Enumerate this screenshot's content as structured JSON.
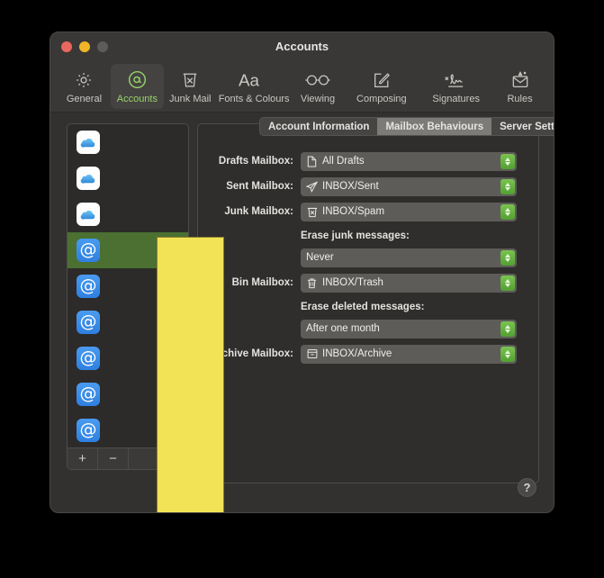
{
  "window": {
    "title": "Accounts",
    "traffic_lights": [
      "close-button",
      "minimise-button",
      "zoom-button"
    ]
  },
  "toolbar": {
    "items": [
      {
        "label": "General",
        "icon": "gear-icon",
        "selected": false
      },
      {
        "label": "Accounts",
        "icon": "at-circle-icon",
        "selected": true
      },
      {
        "label": "Junk Mail",
        "icon": "junk-bin-icon",
        "selected": false
      },
      {
        "label": "Fonts & Colours",
        "icon": "font-aa-icon",
        "selected": false
      },
      {
        "label": "Viewing",
        "icon": "glasses-icon",
        "selected": false
      },
      {
        "label": "Composing",
        "icon": "compose-pencil-icon",
        "selected": false
      },
      {
        "label": "Signatures",
        "icon": "signature-icon",
        "selected": false
      },
      {
        "label": "Rules",
        "icon": "rules-envelope-icon",
        "selected": false
      }
    ],
    "accent_colour": "#95d36a"
  },
  "sidebar": {
    "accounts": [
      {
        "icon": "icloud-icon",
        "name": "",
        "selected": false
      },
      {
        "icon": "icloud-icon",
        "name": "",
        "selected": false
      },
      {
        "icon": "icloud-icon",
        "name": "",
        "selected": false
      },
      {
        "icon": "at-account-icon",
        "name": "",
        "selected": true
      },
      {
        "icon": "at-account-icon",
        "name": "",
        "selected": false
      },
      {
        "icon": "at-account-icon",
        "name": "",
        "selected": false
      },
      {
        "icon": "at-account-icon",
        "name": "",
        "selected": false
      },
      {
        "icon": "at-account-icon",
        "name": "",
        "selected": false
      },
      {
        "icon": "at-account-icon",
        "name": "",
        "selected": false
      }
    ],
    "footer": {
      "add_label": "+",
      "remove_label": "−"
    },
    "selection_colour": "#4b7031",
    "redaction_colour": "#f2e356"
  },
  "panel": {
    "tabs": [
      {
        "label": "Account Information",
        "active": false
      },
      {
        "label": "Mailbox Behaviours",
        "active": true
      },
      {
        "label": "Server Settings",
        "active": false
      }
    ],
    "rows": [
      {
        "kind": "field",
        "label": "Drafts Mailbox:",
        "icon": "document-icon",
        "value": "All Drafts"
      },
      {
        "kind": "field",
        "label": "Sent Mailbox:",
        "icon": "paper-plane-icon",
        "value": "INBOX/Sent"
      },
      {
        "kind": "field",
        "label": "Junk Mailbox:",
        "icon": "junk-bin-icon",
        "value": "INBOX/Spam"
      },
      {
        "kind": "sublabel",
        "label": "Erase junk messages:"
      },
      {
        "kind": "field",
        "label": "",
        "icon": "none",
        "value": "Never"
      },
      {
        "kind": "field",
        "label": "Bin Mailbox:",
        "icon": "trash-icon",
        "value": "INBOX/Trash"
      },
      {
        "kind": "sublabel",
        "label": "Erase deleted messages:"
      },
      {
        "kind": "field",
        "label": "",
        "icon": "none",
        "value": "After one month"
      },
      {
        "kind": "field",
        "label": "Archive Mailbox:",
        "icon": "archive-box-icon",
        "value": "INBOX/Archive"
      }
    ],
    "stepper_colour": "#64b53f"
  },
  "help": {
    "label": "?"
  }
}
